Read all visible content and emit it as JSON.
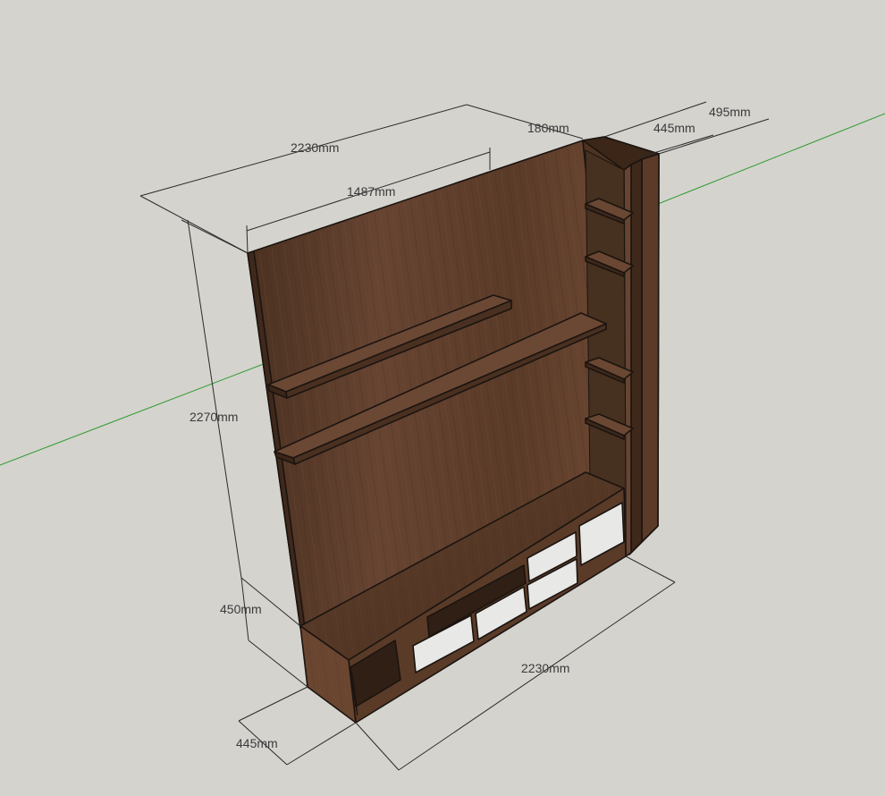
{
  "colors": {
    "background": "#d4d3ce",
    "wood": "#5a3b27",
    "wood_dark": "#3f291b",
    "wood_light": "#6e4a31",
    "drawer_front": "#e6e6e4",
    "green_axis": "#2e9a2e"
  },
  "dimensions": {
    "overall_width": "2230mm",
    "upper_shelf_width": "1487mm",
    "side_gap": "180mm",
    "side_depth_outer": "495mm",
    "side_depth_inner": "445mm",
    "overall_height": "2270mm",
    "base_height": "450mm",
    "base_depth": "445mm",
    "base_width": "2230mm"
  }
}
